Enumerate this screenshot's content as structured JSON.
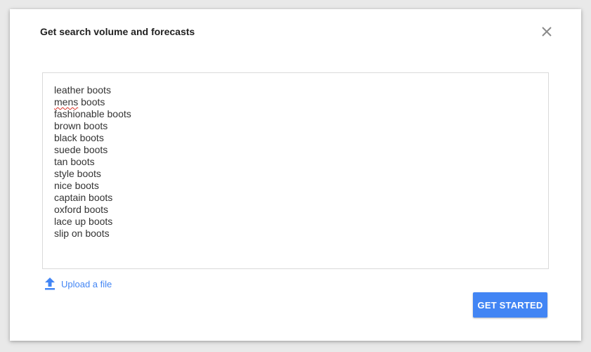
{
  "dialog": {
    "title": "Get search volume and forecasts",
    "close_icon": "close-icon"
  },
  "keywords": {
    "items": [
      {
        "text": "leather boots",
        "misspelled": false
      },
      {
        "text": "mens",
        "suffix": " boots",
        "misspelled": true
      },
      {
        "text": "fashionable boots",
        "misspelled": false
      },
      {
        "text": "brown boots",
        "misspelled": false
      },
      {
        "text": "black boots",
        "misspelled": false
      },
      {
        "text": "suede boots",
        "misspelled": false
      },
      {
        "text": "tan boots",
        "misspelled": false
      },
      {
        "text": "style boots",
        "misspelled": false
      },
      {
        "text": "nice boots",
        "misspelled": false
      },
      {
        "text": "captain boots",
        "misspelled": false
      },
      {
        "text": "oxford boots",
        "misspelled": false
      },
      {
        "text": "lace up boots",
        "misspelled": false
      },
      {
        "text": "slip on boots",
        "misspelled": false
      }
    ]
  },
  "upload": {
    "label": "Upload a file",
    "icon": "upload-icon"
  },
  "actions": {
    "get_started_label": "GET STARTED"
  },
  "colors": {
    "accent": "#4285f4",
    "spellcheck": "#d93025"
  }
}
